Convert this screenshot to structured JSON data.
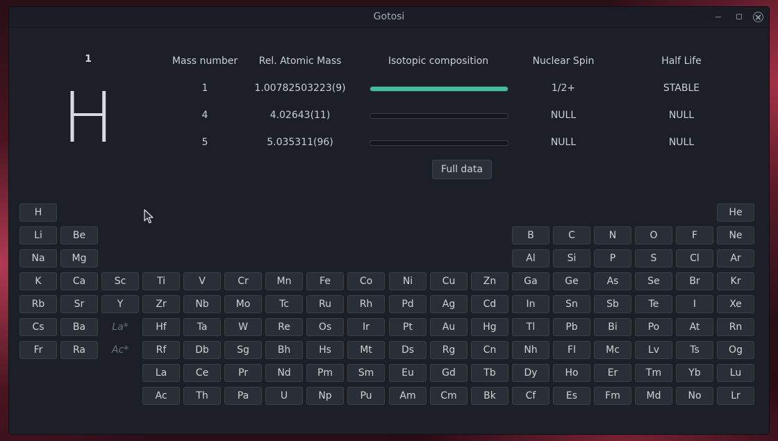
{
  "window": {
    "title": "Gotosi",
    "controls": [
      "minimize-icon",
      "maximize-icon",
      "close-icon"
    ]
  },
  "element_info": {
    "atomic_number": "1",
    "symbol": "H"
  },
  "isotope_table": {
    "headers": [
      "Mass number",
      "Rel. Atomic Mass",
      "Isotopic composition",
      "Nuclear Spin",
      "Half Life"
    ],
    "rows": [
      {
        "mass_number": "1",
        "atomic_mass": "1.00782503223(9)",
        "composition_fraction": 1.0,
        "nuclear_spin": "1/2+",
        "half_life": "STABLE"
      },
      {
        "mass_number": "4",
        "atomic_mass": "4.02643(11)",
        "composition_fraction": 0.0,
        "nuclear_spin": "NULL",
        "half_life": "NULL"
      },
      {
        "mass_number": "5",
        "atomic_mass": "5.035311(96)",
        "composition_fraction": 0.0,
        "nuclear_spin": "NULL",
        "half_life": "NULL"
      }
    ],
    "full_data_label": "Full data"
  },
  "colors": {
    "accent": "#3ec2a4",
    "window_bg": "#1c1f26",
    "button_bg": "#2a2e36"
  },
  "periodic_table": {
    "rows": [
      [
        "H",
        "",
        "",
        "",
        "",
        "",
        "",
        "",
        "",
        "",
        "",
        "",
        "",
        "",
        "",
        "",
        "",
        "He"
      ],
      [
        "Li",
        "Be",
        "",
        "",
        "",
        "",
        "",
        "",
        "",
        "",
        "",
        "",
        "B",
        "C",
        "N",
        "O",
        "F",
        "Ne"
      ],
      [
        "Na",
        "Mg",
        "",
        "",
        "",
        "",
        "",
        "",
        "",
        "",
        "",
        "",
        "Al",
        "Si",
        "P",
        "S",
        "Cl",
        "Ar"
      ],
      [
        "K",
        "Ca",
        "Sc",
        "Ti",
        "V",
        "Cr",
        "Mn",
        "Fe",
        "Co",
        "Ni",
        "Cu",
        "Zn",
        "Ga",
        "Ge",
        "As",
        "Se",
        "Br",
        "Kr"
      ],
      [
        "Rb",
        "Sr",
        "Y",
        "Zr",
        "Nb",
        "Mo",
        "Tc",
        "Ru",
        "Rh",
        "Pd",
        "Ag",
        "Cd",
        "In",
        "Sn",
        "Sb",
        "Te",
        "I",
        "Xe"
      ],
      [
        "Cs",
        "Ba",
        "La*",
        "Hf",
        "Ta",
        "W",
        "Re",
        "Os",
        "Ir",
        "Pt",
        "Au",
        "Hg",
        "Tl",
        "Pb",
        "Bi",
        "Po",
        "At",
        "Rn"
      ],
      [
        "Fr",
        "Ra",
        "Ac*",
        "Rf",
        "Db",
        "Sg",
        "Bh",
        "Hs",
        "Mt",
        "Ds",
        "Rg",
        "Cn",
        "Nh",
        "Fl",
        "Mc",
        "Lv",
        "Ts",
        "Og"
      ],
      [
        "",
        "",
        "",
        "La",
        "Ce",
        "Pr",
        "Nd",
        "Pm",
        "Sm",
        "Eu",
        "Gd",
        "Tb",
        "Dy",
        "Ho",
        "Er",
        "Tm",
        "Yb",
        "Lu"
      ],
      [
        "",
        "",
        "",
        "Ac",
        "Th",
        "Pa",
        "U",
        "Np",
        "Pu",
        "Am",
        "Cm",
        "Bk",
        "Cf",
        "Es",
        "Fm",
        "Md",
        "No",
        "Lr"
      ]
    ],
    "placeholders": [
      "La*",
      "Ac*"
    ]
  }
}
